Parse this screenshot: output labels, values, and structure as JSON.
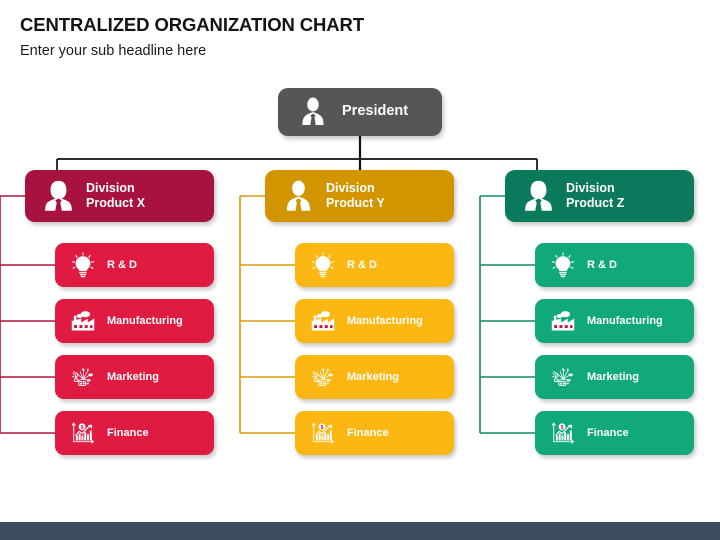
{
  "header": {
    "title": "CENTRALIZED ORGANIZATION CHART",
    "subtitle": "Enter your sub headline here"
  },
  "root": {
    "label": "President",
    "icon": "person-suit-icon",
    "color": "#565656"
  },
  "columns": [
    {
      "id": "product-x",
      "division": {
        "label": "Division\nProduct X",
        "icon": "person-female-icon",
        "color": "#a8123e"
      },
      "accent": "#e01b42",
      "line_color": "#b3153f",
      "items": [
        {
          "label": "R & D",
          "icon": "lightbulb-gear-icon"
        },
        {
          "label": "Manufacturing",
          "icon": "factory-icon"
        },
        {
          "label": "Marketing",
          "icon": "social-network-icon"
        },
        {
          "label": "Finance",
          "icon": "chart-dollar-icon"
        }
      ]
    },
    {
      "id": "product-y",
      "division": {
        "label": "Division\nProduct Y",
        "icon": "person-male-icon",
        "color": "#d29500"
      },
      "accent": "#fcb713",
      "line_color": "#d79b08",
      "items": [
        {
          "label": "R & D",
          "icon": "lightbulb-gear-icon"
        },
        {
          "label": "Manufacturing",
          "icon": "factory-icon"
        },
        {
          "label": "Marketing",
          "icon": "social-network-icon"
        },
        {
          "label": "Finance",
          "icon": "chart-dollar-icon"
        }
      ]
    },
    {
      "id": "product-z",
      "division": {
        "label": "Division\nProduct Z",
        "icon": "person-female-icon",
        "color": "#0b7a5c"
      },
      "accent": "#11a87b",
      "line_color": "#0e8a63",
      "items": [
        {
          "label": "R & D",
          "icon": "lightbulb-gear-icon"
        },
        {
          "label": "Manufacturing",
          "icon": "factory-icon"
        },
        {
          "label": "Marketing",
          "icon": "social-network-icon"
        },
        {
          "label": "Finance",
          "icon": "chart-dollar-icon"
        }
      ]
    }
  ],
  "footer": {
    "color": "#3f4d63"
  },
  "connector": {
    "root_color": "#111111"
  }
}
